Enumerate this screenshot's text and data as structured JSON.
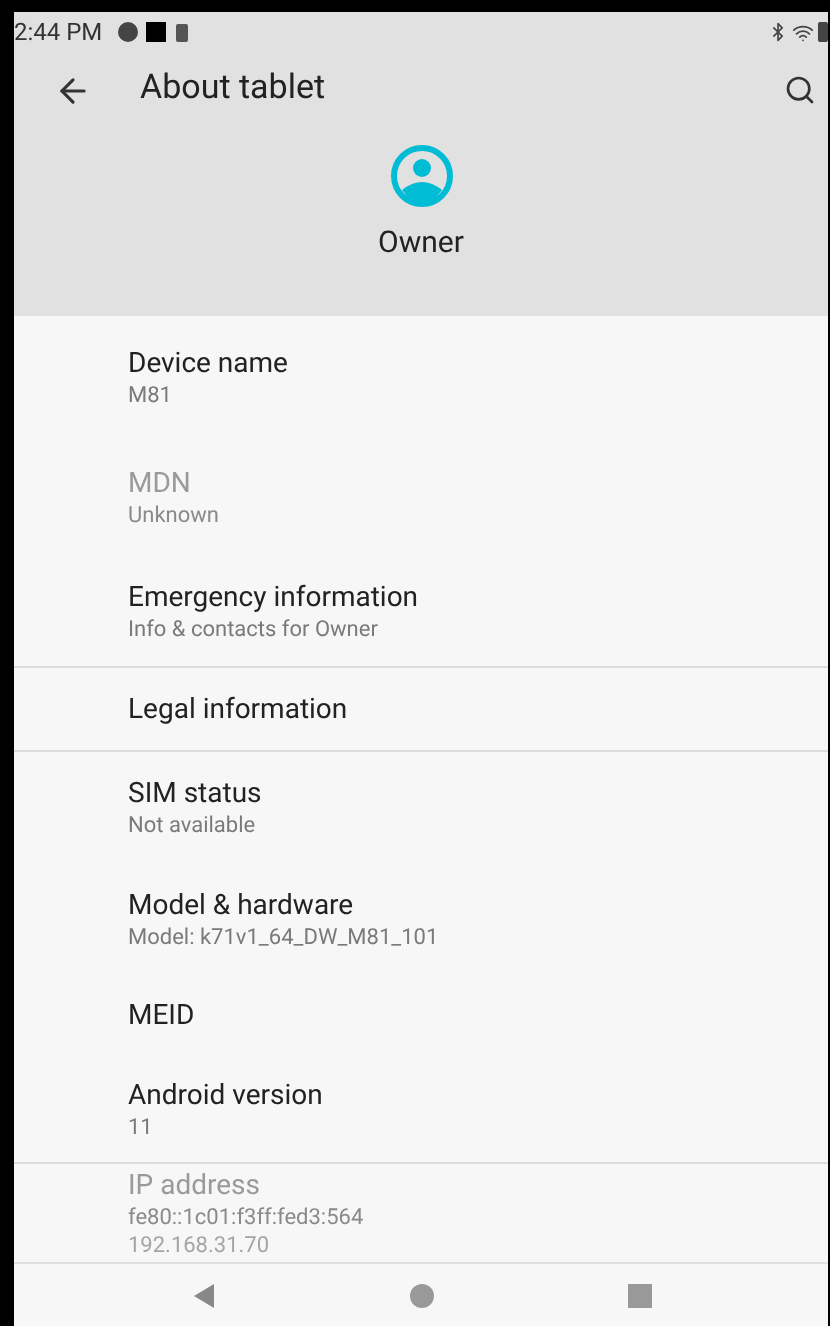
{
  "status_bar": {
    "time": "2:44 PM"
  },
  "toolbar": {
    "title": "About tablet"
  },
  "profile": {
    "name": "Owner"
  },
  "items": [
    {
      "title": "Device name",
      "subtitle": [
        "M81"
      ],
      "disabled": false,
      "divider": false
    },
    {
      "title": "MDN",
      "subtitle": [
        "Unknown"
      ],
      "disabled": true,
      "divider": false
    },
    {
      "title": "Emergency information",
      "subtitle": [
        "Info & contacts for Owner"
      ],
      "disabled": false,
      "divider": true
    },
    {
      "title": "Legal information",
      "disabled": false,
      "divider": true
    },
    {
      "title": "SIM status",
      "subtitle": [
        "Not available"
      ],
      "disabled": false,
      "divider": false
    },
    {
      "title": "Model & hardware",
      "subtitle": [
        "Model: k71v1_64_DW_M81_101"
      ],
      "disabled": false,
      "divider": false
    },
    {
      "title": "MEID",
      "disabled": false,
      "divider": false
    },
    {
      "title": "Android version",
      "subtitle": [
        "11"
      ],
      "disabled": false,
      "divider": true
    },
    {
      "title": "IP address",
      "subtitle": [
        "fe80::1c01:f3ff:fed3:564",
        "192.168.31.70"
      ],
      "disabled": true,
      "divider": false
    }
  ]
}
